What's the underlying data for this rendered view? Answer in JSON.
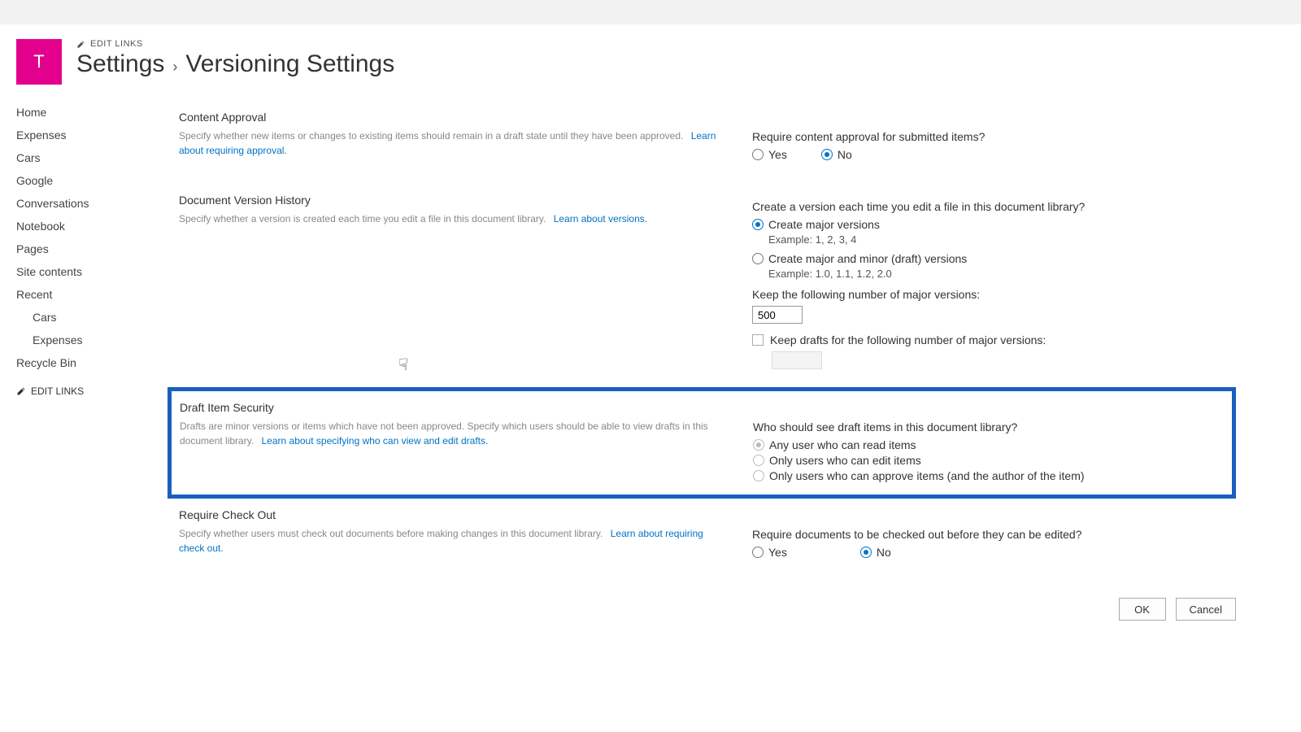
{
  "site_logo_letter": "T",
  "edit_links_label": "EDIT LINKS",
  "breadcrumb": {
    "root": "Settings",
    "current": "Versioning Settings"
  },
  "sidenav": {
    "items": [
      "Home",
      "Expenses",
      "Cars",
      "Google",
      "Conversations",
      "Notebook",
      "Pages",
      "Site contents",
      "Recent"
    ],
    "recent_sub": [
      "Cars",
      "Expenses"
    ],
    "after": [
      "Recycle Bin"
    ],
    "edit_links": "EDIT LINKS"
  },
  "sections": {
    "content_approval": {
      "title": "Content Approval",
      "desc": "Specify whether new items or changes to existing items should remain in a draft state until they have been approved.",
      "link": "Learn about requiring approval.",
      "question": "Require content approval for submitted items?",
      "yes": "Yes",
      "no": "No"
    },
    "version_history": {
      "title": "Document Version History",
      "desc": "Specify whether a version is created each time you edit a file in this document library.",
      "link": "Learn about versions.",
      "question": "Create a version each time you edit a file in this document library?",
      "opt_major": "Create major versions",
      "opt_major_ex": "Example: 1, 2, 3, 4",
      "opt_minor": "Create major and minor (draft) versions",
      "opt_minor_ex": "Example: 1.0, 1.1, 1.2, 2.0",
      "keep_major": "Keep the following number of major versions:",
      "keep_major_value": "500",
      "keep_drafts": "Keep drafts for the following number of major versions:",
      "keep_drafts_value": ""
    },
    "draft_security": {
      "title": "Draft Item Security",
      "desc": "Drafts are minor versions or items which have not been approved. Specify which users should be able to view drafts in this document library.",
      "link": "Learn about specifying who can view and edit drafts.",
      "question": "Who should see draft items in this document library?",
      "opt1": "Any user who can read items",
      "opt2": "Only users who can edit items",
      "opt3": "Only users who can approve items (and the author of the item)"
    },
    "checkout": {
      "title": "Require Check Out",
      "desc": "Specify whether users must check out documents before making changes in this document library.",
      "link": "Learn about requiring check out.",
      "question": "Require documents to be checked out before they can be edited?",
      "yes": "Yes",
      "no": "No"
    }
  },
  "buttons": {
    "ok": "OK",
    "cancel": "Cancel"
  }
}
